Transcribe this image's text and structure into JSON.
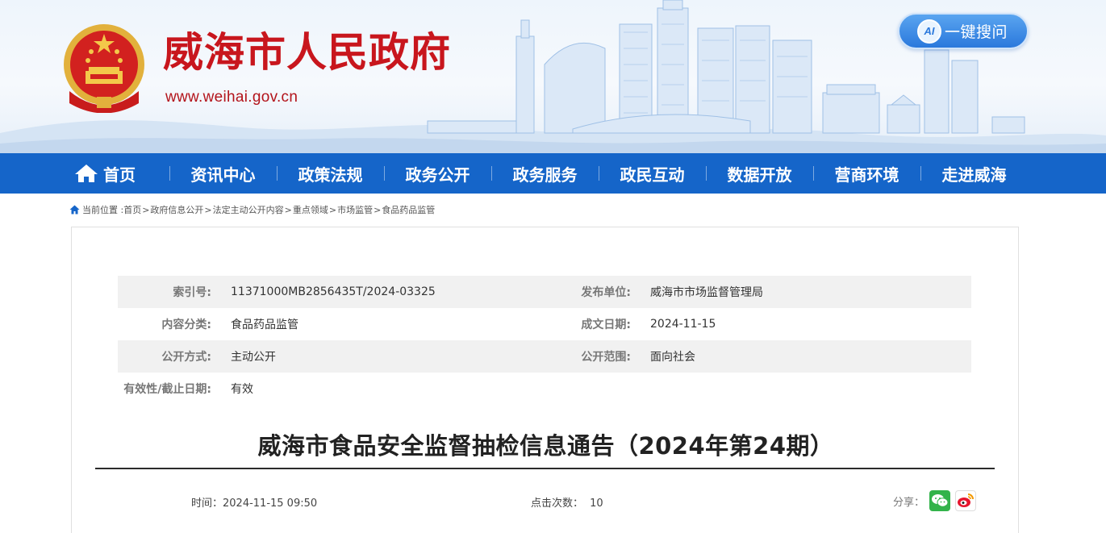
{
  "header": {
    "site_title": "威海市人民政府",
    "site_url": "www.weihai.gov.cn",
    "ai_button_icon_text": "AI",
    "ai_button_label": "一键搜问",
    "colors": {
      "title_red": "#c8161d",
      "nav_blue": "#1565c9",
      "ai_blue": "#2a78dc"
    }
  },
  "nav": {
    "items": [
      "首页",
      "资讯中心",
      "政策法规",
      "政务公开",
      "政务服务",
      "政民互动",
      "数据开放",
      "营商环境",
      "走进威海"
    ]
  },
  "breadcrumb": {
    "prefix": "当前位置 :",
    "items": [
      "首页",
      "政府信息公开",
      "法定主动公开内容",
      "重点领域",
      "市场监管",
      "食品药品监管"
    ],
    "separator": ">"
  },
  "meta": {
    "rows": [
      {
        "k1": "索引号:",
        "v1": "11371000MB2856435T/2024-03325",
        "k2": "发布单位:",
        "v2": "威海市市场监督管理局"
      },
      {
        "k1": "内容分类:",
        "v1": "食品药品监管",
        "k2": "成文日期:",
        "v2": "2024-11-15"
      },
      {
        "k1": "公开方式:",
        "v1": "主动公开",
        "k2": "公开范围:",
        "v2": "面向社会"
      },
      {
        "k1": "有效性/截止日期:",
        "v1": "有效",
        "k2": "",
        "v2": ""
      }
    ]
  },
  "article": {
    "title": "威海市食品安全监督抽检信息通告（2024年第24期）",
    "time_label": "时间：2024-11-15 09:50",
    "clicks_label": "点击次数：",
    "clicks_value": "10",
    "share_label": "分享："
  }
}
